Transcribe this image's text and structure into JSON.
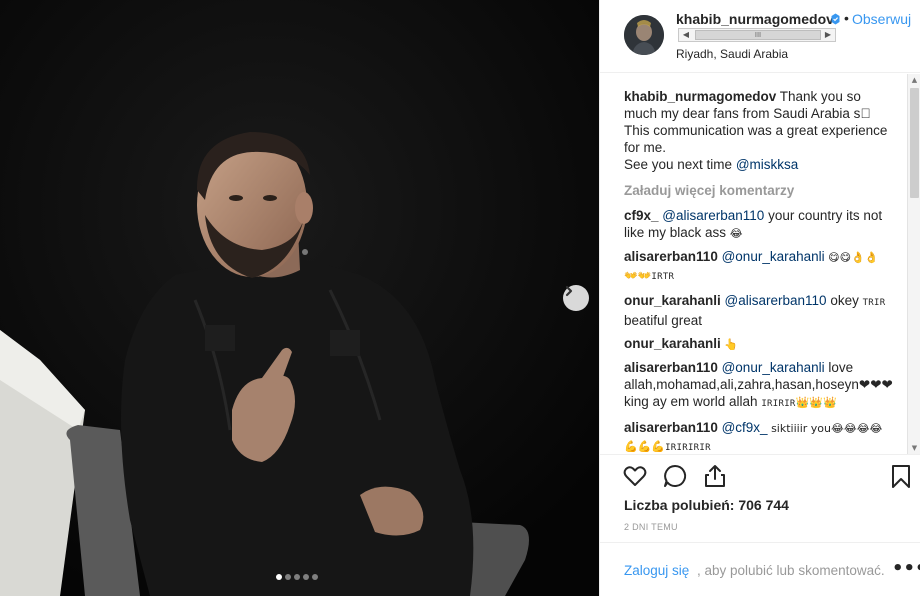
{
  "post": {
    "username": "khabib_nurmagomedov",
    "separator": "•",
    "follow_label": "Obserwuj",
    "location": "Riyadh, Saudi Arabia",
    "scroll_thumb_grip": "III",
    "icons": {
      "verified": "verified-badge-icon",
      "next": "chevron-right-icon",
      "like": "heart-icon",
      "comment": "comment-icon",
      "share": "share-icon",
      "save": "bookmark-icon",
      "more": "ellipsis-icon"
    },
    "colors": {
      "link": "#3897f0",
      "mention": "#003569",
      "muted": "#999999"
    }
  },
  "carousel": {
    "slide_count": 5,
    "active_index": 0
  },
  "caption": {
    "username": "khabib_nurmagomedov",
    "text_line1": " Thank you so much my dear fans from Saudi Arabia s⃞ This communication was a great experience for me.",
    "text_line2": "See you next time ",
    "mention": "@miskksa"
  },
  "load_more": "Załaduj więcej komentarzy",
  "comments": [
    {
      "username": "cf9x_",
      "mention": "@alisarerban110",
      "text": " your country its not like my black ass",
      "emoji": "😂"
    },
    {
      "username": "alisarerban110",
      "mention": "@onur_karahanli",
      "text": " 😋😋👌👌",
      "tail_emoji": "👐👐",
      "tail_text": "IRTR"
    },
    {
      "username": "onur_karahanli",
      "mention": "@alisarerban110",
      "text": " okey ",
      "tag": "TRIR",
      "text2": " beatiful great"
    },
    {
      "username": "onur_karahanli",
      "mention": "",
      "text": " 👆"
    },
    {
      "username": "alisarerban110",
      "mention": "@onur_karahanli",
      "text": " love allah,mohamad,ali,zahra,hasan,hoseyn❤❤❤ king ay em world allah ",
      "tag": "IRIRIR",
      "emoji": "👑👑👑"
    },
    {
      "username": "alisarerban110",
      "mention": "@cf9x_",
      "text": " siktiiiir you😂😂😂😂",
      "tail_emoji": "💪💪💪",
      "tail_text": "IRIRIRIR"
    }
  ],
  "likes_label": "Liczba polubień: 706 744",
  "time_ago": "2 DNI TEMU",
  "login": {
    "link": "Zaloguj się",
    "text": ", aby polubić lub skomentować.",
    "more": "•••"
  }
}
